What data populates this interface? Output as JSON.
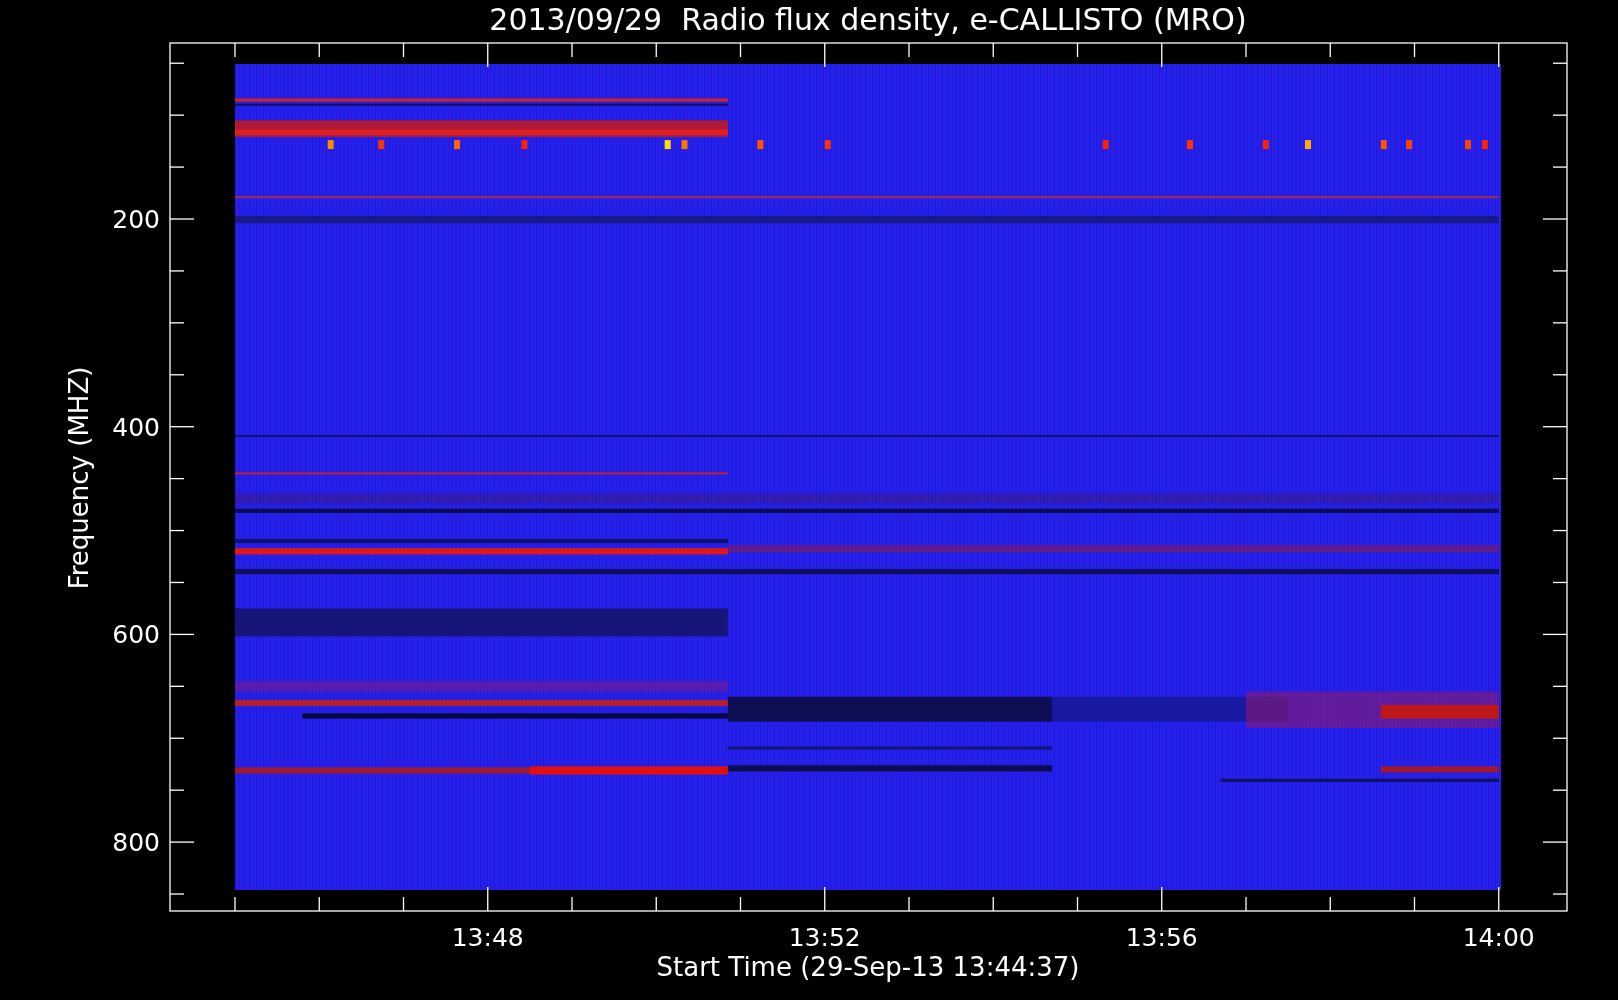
{
  "title": "2013/09/29  Radio flux density, e-CALLISTO (MRO)",
  "y_axis": {
    "label": "Frequency (MHZ)",
    "ticks": [
      "200",
      "400",
      "600",
      "800"
    ]
  },
  "x_axis": {
    "label": "Start Time (29-Sep-13 13:44:37)",
    "ticks": [
      "13:48",
      "13:52",
      "13:56",
      "14:00"
    ]
  }
}
